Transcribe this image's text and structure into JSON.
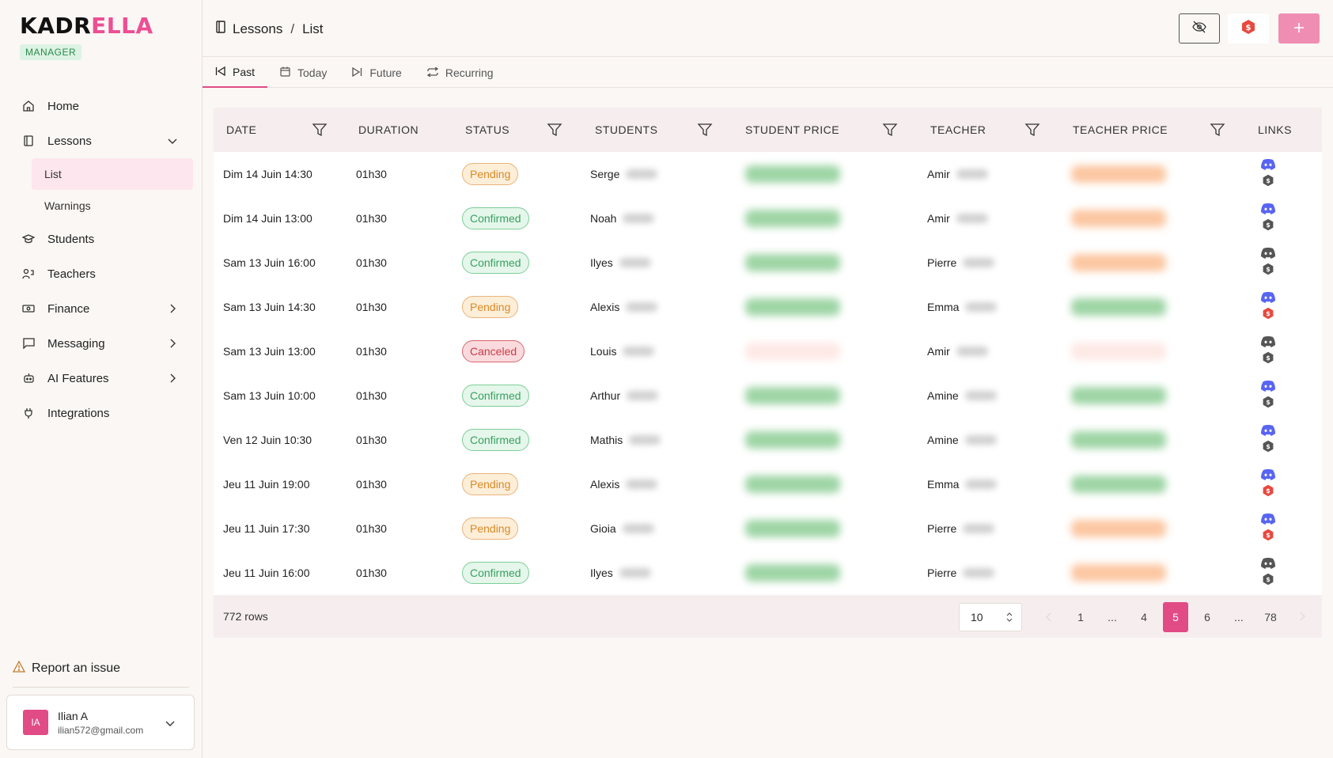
{
  "brand": {
    "part1": "KADR",
    "part2": "ELLA",
    "role": "MANAGER"
  },
  "nav": {
    "home": "Home",
    "lessons": "Lessons",
    "list": "List",
    "warnings": "Warnings",
    "students": "Students",
    "teachers": "Teachers",
    "finance": "Finance",
    "messaging": "Messaging",
    "ai": "AI Features",
    "integrations": "Integrations"
  },
  "report": "Report an issue",
  "user": {
    "initials": "IA",
    "name": "Ilian A",
    "email": "ilian572@gmail.com"
  },
  "breadcrumb": {
    "section": "Lessons",
    "sep": "/",
    "page": "List"
  },
  "tabs": {
    "past": "Past",
    "today": "Today",
    "future": "Future",
    "recurring": "Recurring"
  },
  "columns": {
    "date": "DATE",
    "duration": "DURATION",
    "status": "STATUS",
    "students": "STUDENTS",
    "student_price": "STUDENT PRICE",
    "teacher": "TEACHER",
    "teacher_price": "TEACHER PRICE",
    "links": "LINKS"
  },
  "rows": [
    {
      "date": "Dim 14 Juin 14:30",
      "duration": "01h30",
      "status": "Pending",
      "student": "Serge",
      "sp": "green",
      "teacher": "Amir",
      "tp": "orange",
      "discord": "blue",
      "coin": "gray"
    },
    {
      "date": "Dim 14 Juin 13:00",
      "duration": "01h30",
      "status": "Confirmed",
      "student": "Noah",
      "sp": "green",
      "teacher": "Amir",
      "tp": "orange",
      "discord": "blue",
      "coin": "gray"
    },
    {
      "date": "Sam 13 Juin 16:00",
      "duration": "01h30",
      "status": "Confirmed",
      "student": "Ilyes",
      "sp": "green",
      "teacher": "Pierre",
      "tp": "orange",
      "discord": "gray",
      "coin": "gray"
    },
    {
      "date": "Sam 13 Juin 14:30",
      "duration": "01h30",
      "status": "Pending",
      "student": "Alexis",
      "sp": "green",
      "teacher": "Emma",
      "tp": "green",
      "discord": "blue",
      "coin": "red"
    },
    {
      "date": "Sam 13 Juin 13:00",
      "duration": "01h30",
      "status": "Canceled",
      "student": "Louis",
      "sp": "faint",
      "teacher": "Amir",
      "tp": "faint",
      "discord": "gray",
      "coin": "gray"
    },
    {
      "date": "Sam 13 Juin 10:00",
      "duration": "01h30",
      "status": "Confirmed",
      "student": "Arthur",
      "sp": "green",
      "teacher": "Amine",
      "tp": "green",
      "discord": "blue",
      "coin": "gray"
    },
    {
      "date": "Ven 12 Juin 10:30",
      "duration": "01h30",
      "status": "Confirmed",
      "student": "Mathis",
      "sp": "green",
      "teacher": "Amine",
      "tp": "green",
      "discord": "blue",
      "coin": "gray"
    },
    {
      "date": "Jeu 11 Juin 19:00",
      "duration": "01h30",
      "status": "Pending",
      "student": "Alexis",
      "sp": "green",
      "teacher": "Emma",
      "tp": "green",
      "discord": "blue",
      "coin": "red"
    },
    {
      "date": "Jeu 11 Juin 17:30",
      "duration": "01h30",
      "status": "Pending",
      "student": "Gioia",
      "sp": "green",
      "teacher": "Pierre",
      "tp": "orange",
      "discord": "blue",
      "coin": "red"
    },
    {
      "date": "Jeu 11 Juin 16:00",
      "duration": "01h30",
      "status": "Confirmed",
      "student": "Ilyes",
      "sp": "green",
      "teacher": "Pierre",
      "tp": "orange",
      "discord": "gray",
      "coin": "gray"
    }
  ],
  "footer": {
    "rows_label": "772 rows",
    "page_size": "10",
    "pages": [
      "1",
      "...",
      "4",
      "5",
      "6",
      "...",
      "78"
    ],
    "current_page": "5"
  },
  "colors": {
    "accent": "#e14b86",
    "discord_blue": "#5865f2",
    "discord_gray": "#555555",
    "coin_gray": "#555555",
    "coin_red": "#e8493f"
  }
}
